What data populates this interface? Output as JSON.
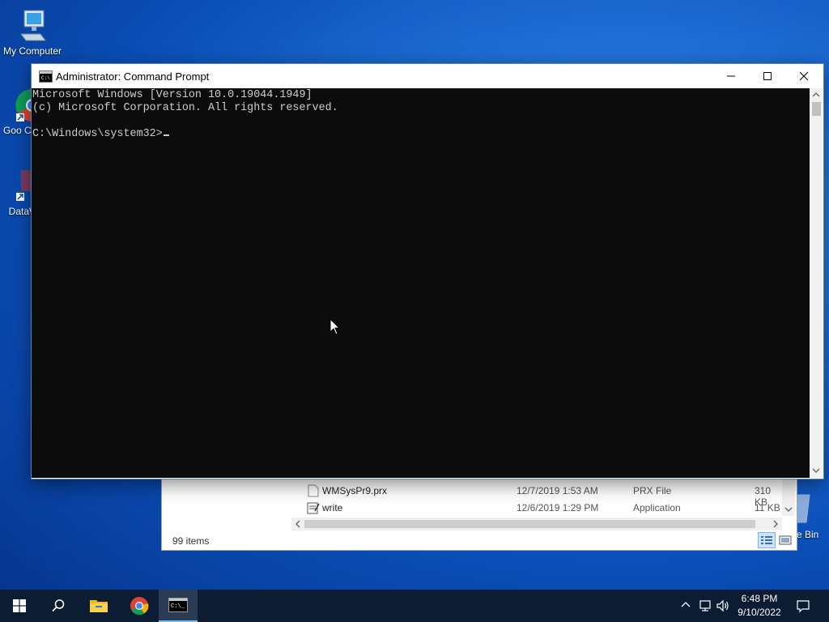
{
  "desktop": {
    "icons": [
      {
        "label": "My Computer",
        "icon": "computer-icon"
      },
      {
        "label": "Goo Chro",
        "icon": "chrome-icon"
      },
      {
        "label": "DataW",
        "icon": "datawrapper-icon"
      }
    ],
    "recycle_bin_label": "e Bin"
  },
  "explorer": {
    "rows": [
      {
        "name": "WMSysPr9.prx",
        "date": "12/7/2019 1:53 AM",
        "type": "PRX File",
        "size": "310 KB",
        "icon": "file-icon"
      },
      {
        "name": "write",
        "date": "12/6/2019 1:29 PM",
        "type": "Application",
        "size": "11 KB",
        "icon": "write-app-icon"
      }
    ],
    "status": "99 items"
  },
  "cmd": {
    "title": "Administrator: Command Prompt",
    "lines": [
      "Microsoft Windows [Version 10.0.19044.1949]",
      "(c) Microsoft Corporation. All rights reserved.",
      "",
      "C:\\Windows\\system32>"
    ],
    "colors": {
      "background": "#0c0c0c",
      "text": "#cccccc"
    }
  },
  "taskbar": {
    "items": [
      "start-icon",
      "search-icon",
      "file-explorer-icon",
      "chrome-icon",
      "command-prompt-icon"
    ],
    "active": "command-prompt-icon",
    "clock_time": "6:48 PM",
    "clock_date": "9/10/2022"
  }
}
